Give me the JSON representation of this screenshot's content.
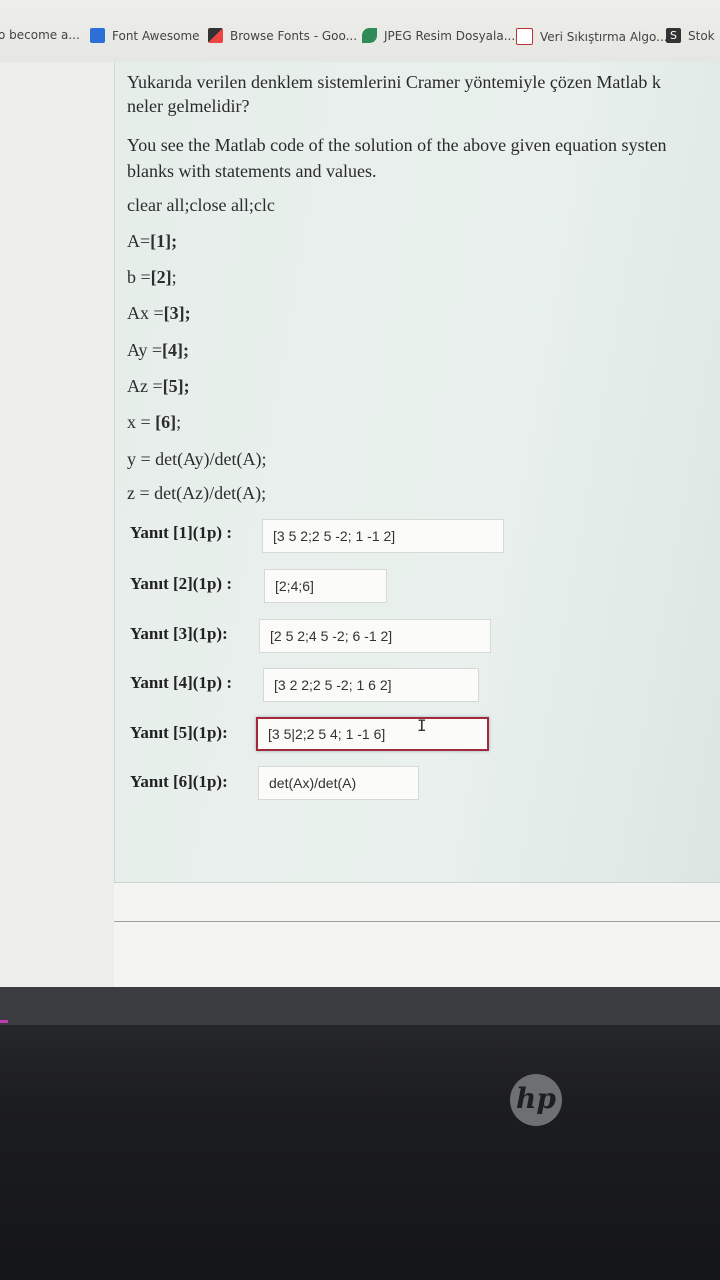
{
  "bookmarks": [
    {
      "label": "o become a...",
      "icon": "none",
      "color": "#000000"
    },
    {
      "label": "Font Awesome",
      "icon": "font-awesome-icon",
      "color": "#2c6fd6"
    },
    {
      "label": "Browse Fonts - Goo...",
      "icon": "google-fonts-icon",
      "color": "#2d2d2d"
    },
    {
      "label": "JPEG Resim Dosyala...",
      "icon": "leaf-icon",
      "color": "#2e8b57"
    },
    {
      "label": "Veri Sıkıştırma Algo...",
      "icon": "slides-icon",
      "color": "#b33"
    },
    {
      "label": "Stok",
      "icon": "s-icon",
      "color": "#333"
    }
  ],
  "question": {
    "tr_line1": "Yukarıda verilen denklem sistemlerini Cramer yöntemiyle çözen Matlab k",
    "tr_line2": "neler gelmelidir?",
    "en_line1": "You see the Matlab code of the solution of the above given equation systen",
    "en_line2": "blanks with statements and values."
  },
  "code": {
    "line1": "clear all;close all;clc",
    "a_pre": "A=",
    "a_blank": "[1]",
    "a_post": ";",
    "b_pre": "b =",
    "b_blank": "[2]",
    "b_post": ";",
    "ax_pre": "Ax =",
    "ax_blank": "[3]",
    "ax_post": ";",
    "ay_pre": "Ay =",
    "ay_blank": "[4]",
    "ay_post": ";",
    "az_pre": "Az =",
    "az_blank": "[5]",
    "az_post": ";",
    "x_pre": "x = ",
    "x_blank": "[6]",
    "x_post": ";",
    "y_line": "y = det(Ay)/det(A);",
    "z_line": "z = det(Az)/det(A);"
  },
  "answers": [
    {
      "label": "Yanıt [1](1p) :",
      "value": "[3 5 2;2 5 -2; 1 -1 2]"
    },
    {
      "label": "Yanıt [2](1p) :",
      "value": "[2;4;6]"
    },
    {
      "label": "Yanıt [3](1p):",
      "value": "[2 5 2;4 5 -2; 6 -1 2]"
    },
    {
      "label": "Yanıt [4](1p) :",
      "value": "[3 2 2;2 5 -2; 1 6 2]"
    },
    {
      "label": "Yanıt [5](1p):",
      "value": "[3 5|2;2 5 4; 1 -1 6]"
    },
    {
      "label": "Yanıt [6](1p):",
      "value": "det(Ax)/det(A)"
    }
  ],
  "colors": {
    "active_border": "#a32a3a",
    "panel": "#e6eeea"
  },
  "laptop": {
    "logo": "hp"
  }
}
